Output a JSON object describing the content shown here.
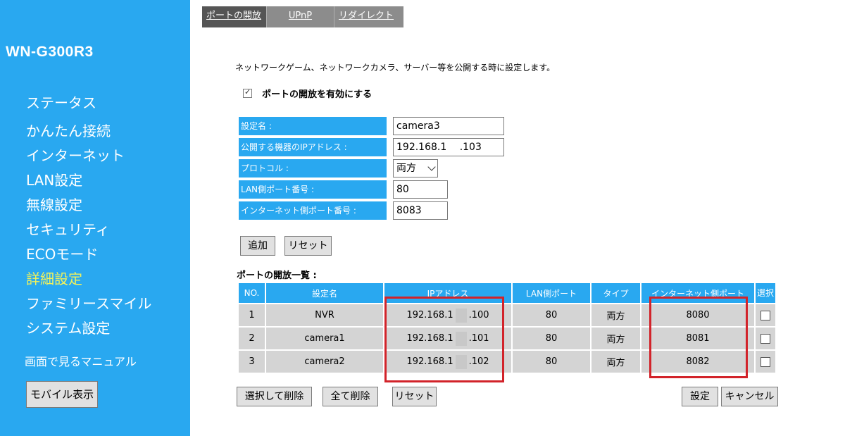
{
  "brand": "WN-G300R3",
  "sidebar": {
    "items": [
      {
        "label": "ステータス"
      },
      {
        "label": "かんたん接続"
      },
      {
        "label": "インターネット"
      },
      {
        "label": "LAN設定"
      },
      {
        "label": "無線設定"
      },
      {
        "label": "セキュリティ"
      },
      {
        "label": "ECOモード"
      },
      {
        "label": "詳細設定"
      },
      {
        "label": "ファミリースマイル"
      },
      {
        "label": "システム設定"
      }
    ],
    "active_item": "詳細設定",
    "manual_link": "画面で見るマニュアル",
    "mobile_button": "モバイル表示"
  },
  "tabs": [
    {
      "label": "ポートの開放"
    },
    {
      "label": "UPnP"
    },
    {
      "label": "リダイレクト"
    }
  ],
  "active_tab": "ポートの開放",
  "intro_text": "ネットワークゲーム、ネットワークカメラ、サーバー等を公開する時に設定します。",
  "enable_checkbox": {
    "label": "ポートの開放を有効にする",
    "checked": true
  },
  "form": {
    "name_label": "設定名 :",
    "name_value": "camera3",
    "ip_label": "公開する機器のIPアドレス :",
    "ip_value": "192.168.1　 .103",
    "protocol_label": "プロトコル :",
    "protocol_value": "両方",
    "lan_port_label": "LAN側ポート番号 :",
    "lan_port_value": "80",
    "wan_port_label": "インターネット側ポート番号 :",
    "wan_port_value": "8083",
    "add_button": "追加",
    "reset_button": "リセット"
  },
  "list": {
    "title": "ポートの開放一覧 :",
    "headers": [
      "NO.",
      "設定名",
      "IPアドレス",
      "LAN側ポート",
      "タイプ",
      "インターネット側ポート",
      "選択"
    ],
    "rows": [
      {
        "no": "1",
        "name": "NVR",
        "ip_prefix": "192.168.1",
        "ip_suffix": ".100",
        "lan_port": "80",
        "type": "両方",
        "wan_port": "8080",
        "selected": false
      },
      {
        "no": "2",
        "name": "camera1",
        "ip_prefix": "192.168.1",
        "ip_suffix": ".101",
        "lan_port": "80",
        "type": "両方",
        "wan_port": "8081",
        "selected": false
      },
      {
        "no": "3",
        "name": "camera2",
        "ip_prefix": "192.168.1",
        "ip_suffix": ".102",
        "lan_port": "80",
        "type": "両方",
        "wan_port": "8082",
        "selected": false
      }
    ]
  },
  "buttons": {
    "delete_selected": "選択して削除",
    "delete_all": "全て削除",
    "reset": "リセット",
    "apply": "設定",
    "cancel": "キャンセル"
  },
  "colors": {
    "sidebar_bg": "#29a8f0",
    "active_nav": "#f2f25a",
    "highlight_red": "#d2232a",
    "cell_gray": "#d4d4d4"
  }
}
